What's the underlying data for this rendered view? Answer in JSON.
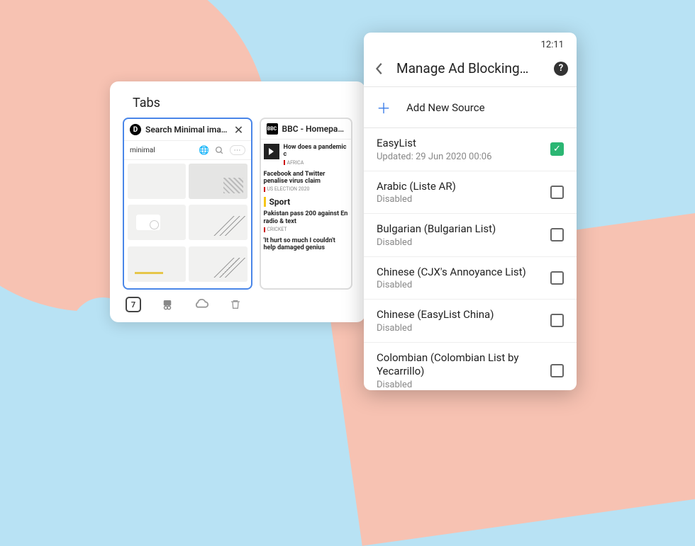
{
  "tabs_window": {
    "title": "Tabs",
    "tab_count": "7",
    "active_tab": {
      "favicon_letter": "D",
      "title": "Search Minimal images o",
      "search_value": "minimal"
    },
    "second_tab": {
      "favicon_text": "BBC",
      "title": "BBC - Homepage",
      "news": [
        {
          "headline": "How does a pandemic c",
          "category": "AFRICA",
          "thumb": true
        },
        {
          "headline": "Facebook and Twitter penalise virus claim",
          "category": "US ELECTION 2020"
        }
      ],
      "sport_label": "Sport",
      "sport_news": [
        {
          "headline": "Pakistan pass 200 against En radio & text",
          "category": "CRICKET"
        },
        {
          "headline": "'It hurt so much I couldn't help damaged genius"
        }
      ]
    }
  },
  "phone": {
    "time": "12:11",
    "app_title": "Manage Ad Blocking…",
    "add_label": "Add New Source",
    "sources": [
      {
        "name": "EasyList",
        "sub": "Updated: 29 Jun 2020 00:06",
        "checked": true
      },
      {
        "name": "Arabic (Liste AR)",
        "sub": "Disabled",
        "checked": false
      },
      {
        "name": "Bulgarian (Bulgarian List)",
        "sub": "Disabled",
        "checked": false
      },
      {
        "name": "Chinese (CJX's Annoyance List)",
        "sub": "Disabled",
        "checked": false
      },
      {
        "name": "Chinese (EasyList China)",
        "sub": "Disabled",
        "checked": false
      },
      {
        "name": "Colombian (Colombian List by Yecarrillo)",
        "sub": "Disabled",
        "checked": false
      }
    ]
  }
}
